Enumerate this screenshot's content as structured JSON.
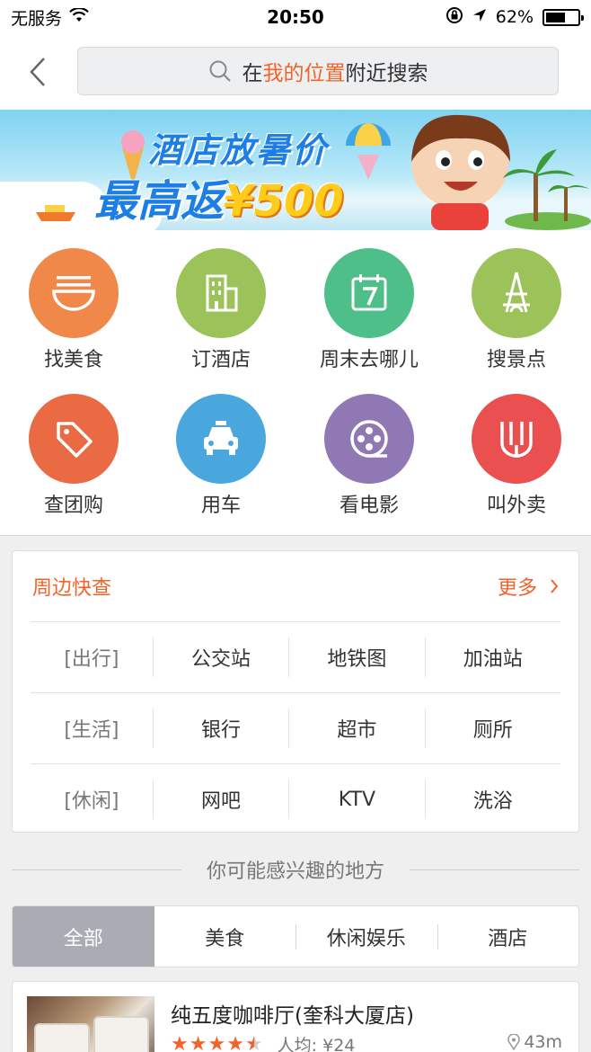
{
  "status_bar": {
    "carrier": "无服务",
    "time": "20:50",
    "battery_percent": "62%",
    "battery_level": 0.62
  },
  "nav": {
    "search_prefix": "在",
    "search_highlight": "我的位置",
    "search_suffix": "附近搜索",
    "accent_color": "#f0642a"
  },
  "banner": {
    "line1": "酒店放暑价",
    "line2_prefix": "最高返",
    "line2_money": "¥500"
  },
  "categories": [
    {
      "label": "找美食",
      "icon": "noodle-bowl-icon",
      "color": "#f0884a"
    },
    {
      "label": "订酒店",
      "icon": "hotel-building-icon",
      "color": "#9bc35a"
    },
    {
      "label": "周末去哪儿",
      "icon": "calendar-icon",
      "color": "#4fbf8a"
    },
    {
      "label": "搜景点",
      "icon": "tower-icon",
      "color": "#9bc35a"
    },
    {
      "label": "查团购",
      "icon": "tag-icon",
      "color": "#ea6a43"
    },
    {
      "label": "用车",
      "icon": "taxi-icon",
      "color": "#4aa7dd"
    },
    {
      "label": "看电影",
      "icon": "film-reel-icon",
      "color": "#8f78b3"
    },
    {
      "label": "叫外卖",
      "icon": "fork-icon",
      "color": "#e9504f"
    }
  ],
  "quick_check": {
    "title": "周边快查",
    "more": "更多",
    "rows": [
      {
        "category": "[出行]",
        "options": [
          "公交站",
          "地铁图",
          "加油站"
        ]
      },
      {
        "category": "[生活]",
        "options": [
          "银行",
          "超市",
          "厕所"
        ]
      },
      {
        "category": "[休闲]",
        "options": [
          "网吧",
          "KTV",
          "洗浴"
        ]
      }
    ]
  },
  "interest": {
    "title": "你可能感兴趣的地方",
    "tabs": [
      "全部",
      "美食",
      "休闲娱乐",
      "酒店"
    ],
    "active_tab": 0
  },
  "place": {
    "name": "纯五度咖啡厅(奎科大厦店)",
    "rating": 4.5,
    "avg_price": "人均: ¥24",
    "distance": "43m"
  }
}
